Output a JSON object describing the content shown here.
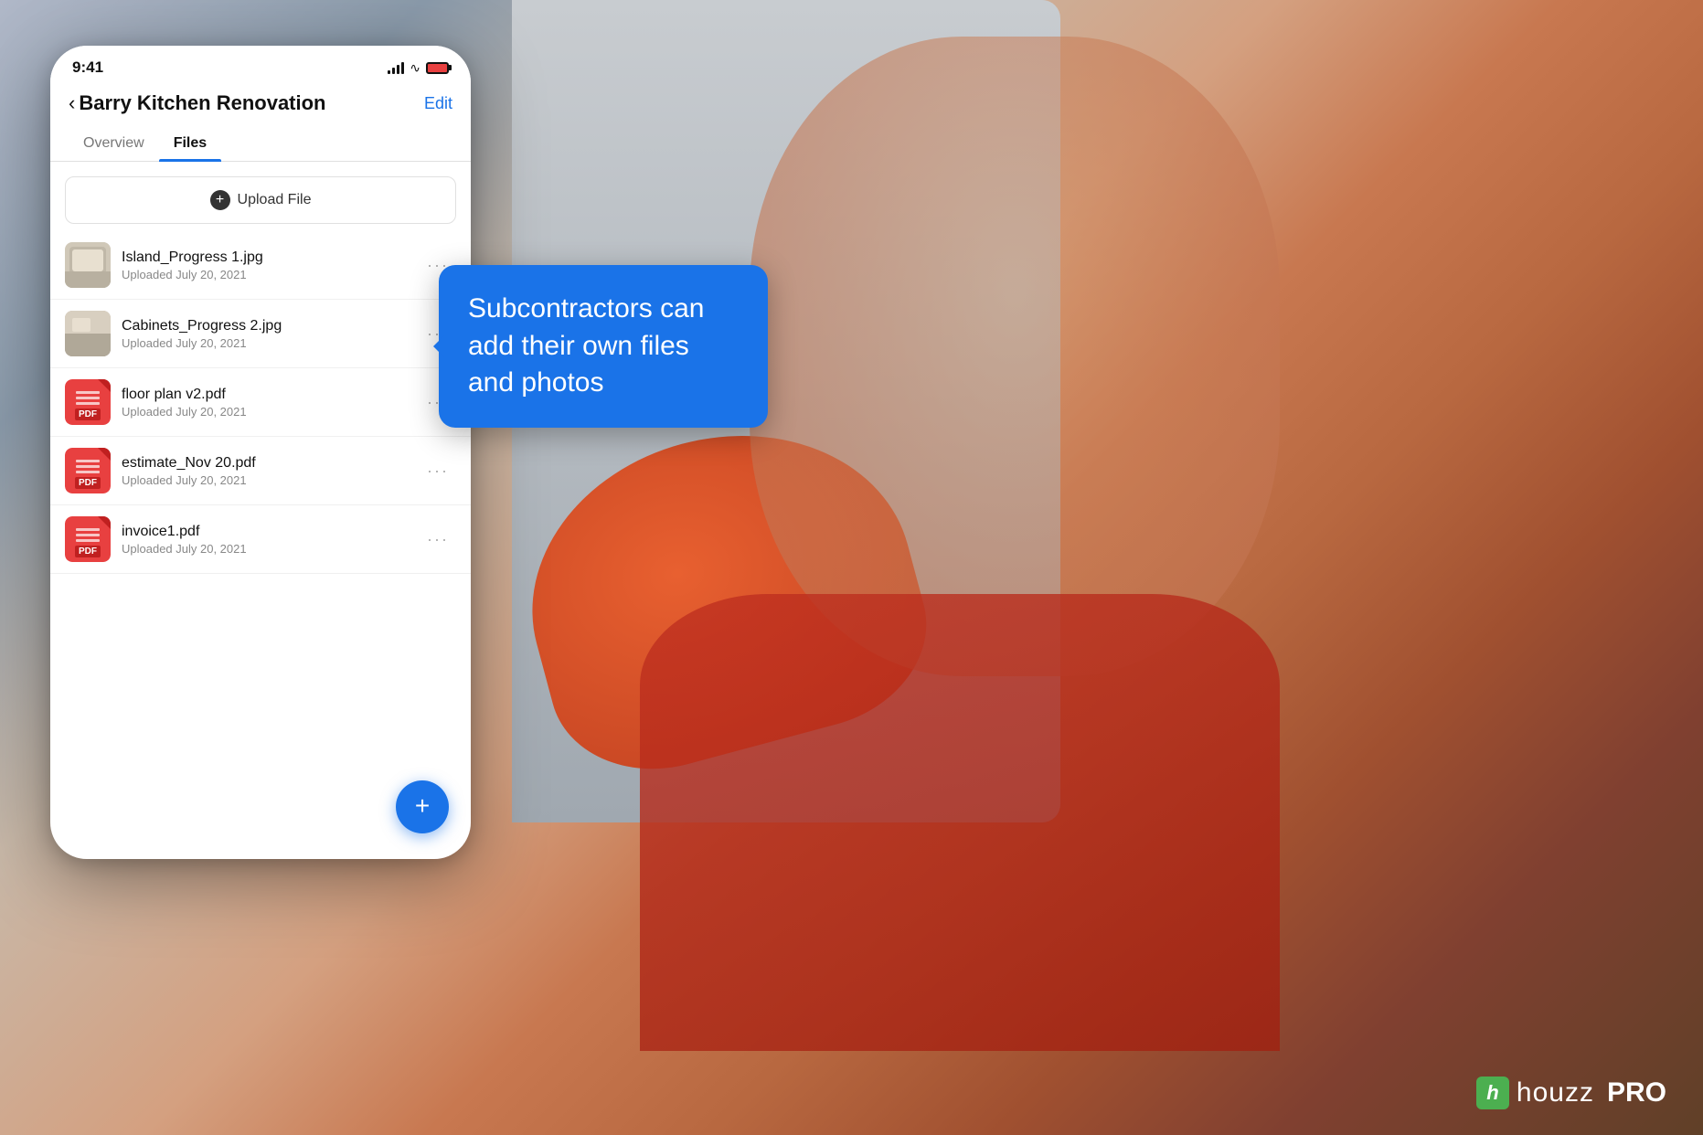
{
  "background": {
    "description": "Construction worker with red hard hat and harness looking at phone"
  },
  "status_bar": {
    "time": "9:41",
    "signal": "signal",
    "wifi": "wifi",
    "battery": "battery"
  },
  "header": {
    "back_label": "‹",
    "title": "Barry Kitchen Renovation",
    "edit_label": "Edit"
  },
  "tabs": [
    {
      "label": "Overview",
      "active": false
    },
    {
      "label": "Files",
      "active": true
    }
  ],
  "upload_button": {
    "label": "Upload File"
  },
  "files": [
    {
      "name": "Island_Progress 1.jpg",
      "date": "Uploaded July 20, 2021",
      "type": "image",
      "thumb": "img1"
    },
    {
      "name": "Cabinets_Progress 2.jpg",
      "date": "Uploaded July 20, 2021",
      "type": "image",
      "thumb": "img2"
    },
    {
      "name": "floor plan v2.pdf",
      "date": "Uploaded July 20, 2021",
      "type": "pdf",
      "thumb": "pdf"
    },
    {
      "name": "estimate_Nov 20.pdf",
      "date": "Uploaded July 20, 2021",
      "type": "pdf",
      "thumb": "pdf"
    },
    {
      "name": "invoice1.pdf",
      "date": "Uploaded July 20, 2021",
      "type": "pdf",
      "thumb": "pdf"
    }
  ],
  "fab": {
    "label": "+"
  },
  "speech_bubble": {
    "text": "Subcontractors can add their own files and photos"
  },
  "logo": {
    "icon_letter": "h",
    "name": "houzz",
    "pro": "PRO"
  },
  "colors": {
    "accent_blue": "#1a73e8",
    "fab_blue": "#1a73e8",
    "pdf_red": "#e84040",
    "text_primary": "#111111",
    "text_secondary": "#888888"
  }
}
